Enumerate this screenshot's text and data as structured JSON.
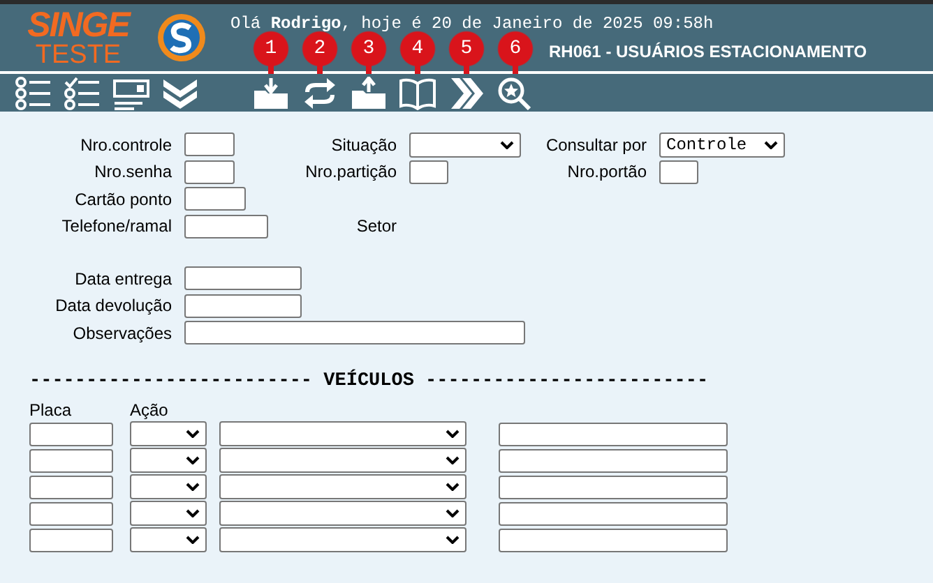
{
  "logo": {
    "line1": "SINGE",
    "line2": "TESTE"
  },
  "header": {
    "greeting": "Olá **Rodrigo**, hoje é 20 de Janeiro de 2025 09:58h",
    "screen_title": "RH061 - USUÁRIOS ESTACIONAMENTO"
  },
  "toolbar": {
    "badges": [
      "1",
      "2",
      "3",
      "4",
      "5",
      "6"
    ]
  },
  "form": {
    "rows": [
      [
        {
          "label": "Nro.controle",
          "kind": "text"
        },
        {
          "label": "Situação",
          "kind": "select"
        },
        {
          "label": "Consultar por",
          "kind": "select",
          "value": "Controle"
        }
      ],
      [
        {
          "label": "Nro.senha",
          "kind": "text"
        },
        {
          "label": "Nro.partição",
          "kind": "text"
        },
        {
          "label": "Nro.portão",
          "kind": "text"
        }
      ],
      [
        {
          "label": "Cartão ponto",
          "kind": "text"
        }
      ],
      [
        {
          "label": "Telefone/ramal",
          "kind": "text"
        },
        {
          "label": "Setor",
          "kind": "label"
        }
      ]
    ],
    "dates": [
      {
        "label": "Data entrega",
        "kind": "text"
      },
      {
        "label": "Data devolução",
        "kind": "text"
      },
      {
        "label": "Observações",
        "kind": "text"
      }
    ]
  },
  "vehicles": {
    "heading": "------------------------- VEÍCULOS -------------------------",
    "columns": [
      "Placa",
      "Ação"
    ],
    "rows": [
      {
        "kind": "entry"
      },
      {
        "kind": "entry"
      },
      {
        "kind": "entry"
      },
      {
        "kind": "entry"
      },
      {
        "kind": "entry"
      }
    ]
  }
}
